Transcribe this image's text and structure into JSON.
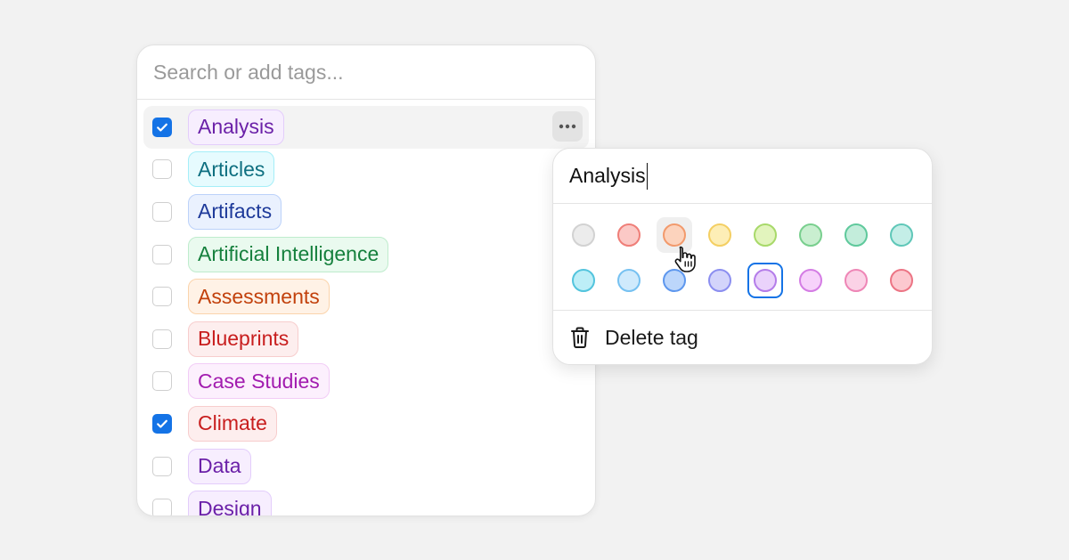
{
  "search": {
    "placeholder": "Search or add tags..."
  },
  "tags": [
    {
      "label": "Analysis",
      "checked": true,
      "color": "purple"
    },
    {
      "label": "Articles",
      "checked": false,
      "color": "cyan"
    },
    {
      "label": "Artifacts",
      "checked": false,
      "color": "blue"
    },
    {
      "label": "Artificial Intelligence",
      "checked": false,
      "color": "green"
    },
    {
      "label": "Assessments",
      "checked": false,
      "color": "orange"
    },
    {
      "label": "Blueprints",
      "checked": false,
      "color": "red"
    },
    {
      "label": "Case Studies",
      "checked": false,
      "color": "fuchsia"
    },
    {
      "label": "Climate",
      "checked": true,
      "color": "red"
    },
    {
      "label": "Data",
      "checked": false,
      "color": "purple"
    },
    {
      "label": "Design",
      "checked": false,
      "color": "purple"
    }
  ],
  "editor": {
    "name_value": "Analysis",
    "delete_label": "Delete tag",
    "colors": [
      {
        "name": "gray",
        "fill": "#ececec",
        "border": "#d2d2d2"
      },
      {
        "name": "red",
        "fill": "#fbc9c6",
        "border": "#ef7e78"
      },
      {
        "name": "orange",
        "fill": "#fcd3bd",
        "border": "#f29a6c"
      },
      {
        "name": "yellow",
        "fill": "#fdeeb6",
        "border": "#f4cf63"
      },
      {
        "name": "lime",
        "fill": "#e2f4bd",
        "border": "#a8d96a"
      },
      {
        "name": "green",
        "fill": "#c9efd0",
        "border": "#79cf8e"
      },
      {
        "name": "emerald",
        "fill": "#c3eddb",
        "border": "#5fc99c"
      },
      {
        "name": "teal",
        "fill": "#c4eee7",
        "border": "#5fc7b8"
      },
      {
        "name": "cyan",
        "fill": "#bdeef7",
        "border": "#52c4dd"
      },
      {
        "name": "sky",
        "fill": "#cfeafc",
        "border": "#76c1f1"
      },
      {
        "name": "blue",
        "fill": "#bcd6fb",
        "border": "#5d97ee"
      },
      {
        "name": "indigo",
        "fill": "#d3d4fb",
        "border": "#8b8ef0"
      },
      {
        "name": "purple",
        "fill": "#ead2fb",
        "border": "#b47ce9"
      },
      {
        "name": "fuchsia",
        "fill": "#f7d2fb",
        "border": "#d47ce4"
      },
      {
        "name": "pink",
        "fill": "#fbd2e6",
        "border": "#ee86b6"
      },
      {
        "name": "rose",
        "fill": "#fcc8cf",
        "border": "#ec7484"
      }
    ],
    "hovered_color": "orange",
    "selected_color": "purple"
  },
  "accent_color": "#1473e6"
}
